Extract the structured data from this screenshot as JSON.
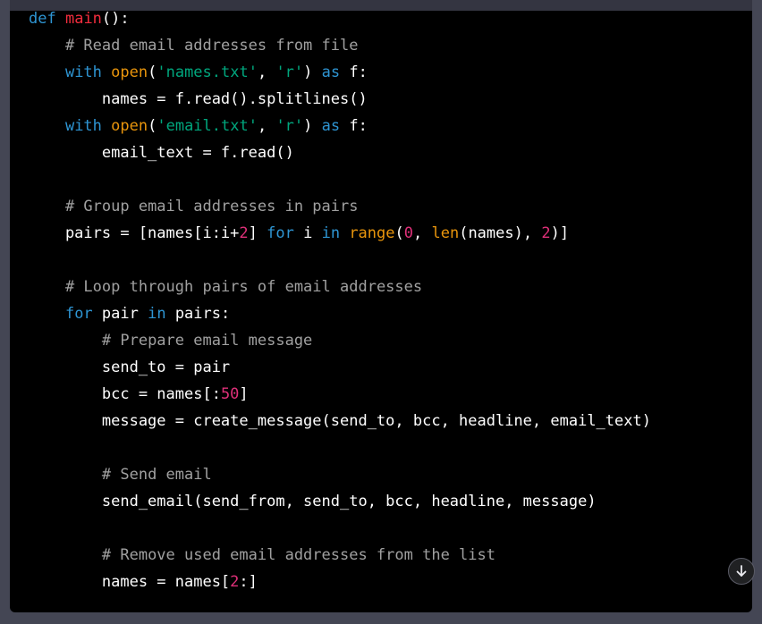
{
  "code_lines": [
    [
      {
        "t": "def",
        "c": "kw"
      },
      {
        "t": " "
      },
      {
        "t": "main",
        "c": "fn"
      },
      {
        "t": "():"
      }
    ],
    [
      {
        "t": "    "
      },
      {
        "t": "# Read email addresses from file",
        "c": "cm"
      }
    ],
    [
      {
        "t": "    "
      },
      {
        "t": "with",
        "c": "kw"
      },
      {
        "t": " "
      },
      {
        "t": "open",
        "c": "bi"
      },
      {
        "t": "("
      },
      {
        "t": "'names.txt'",
        "c": "str"
      },
      {
        "t": ", "
      },
      {
        "t": "'r'",
        "c": "str"
      },
      {
        "t": ") "
      },
      {
        "t": "as",
        "c": "kw"
      },
      {
        "t": " f:"
      }
    ],
    [
      {
        "t": "        names = f.read().splitlines()"
      }
    ],
    [
      {
        "t": "    "
      },
      {
        "t": "with",
        "c": "kw"
      },
      {
        "t": " "
      },
      {
        "t": "open",
        "c": "bi"
      },
      {
        "t": "("
      },
      {
        "t": "'email.txt'",
        "c": "str"
      },
      {
        "t": ", "
      },
      {
        "t": "'r'",
        "c": "str"
      },
      {
        "t": ") "
      },
      {
        "t": "as",
        "c": "kw"
      },
      {
        "t": " f:"
      }
    ],
    [
      {
        "t": "        email_text = f.read()"
      }
    ],
    [],
    [
      {
        "t": "    "
      },
      {
        "t": "# Group email addresses in pairs",
        "c": "cm"
      }
    ],
    [
      {
        "t": "    pairs = [names[i:i+"
      },
      {
        "t": "2",
        "c": "num"
      },
      {
        "t": "] "
      },
      {
        "t": "for",
        "c": "kw"
      },
      {
        "t": " i "
      },
      {
        "t": "in",
        "c": "kw"
      },
      {
        "t": " "
      },
      {
        "t": "range",
        "c": "bi"
      },
      {
        "t": "("
      },
      {
        "t": "0",
        "c": "num"
      },
      {
        "t": ", "
      },
      {
        "t": "len",
        "c": "bi"
      },
      {
        "t": "(names), "
      },
      {
        "t": "2",
        "c": "num"
      },
      {
        "t": ")]"
      }
    ],
    [],
    [
      {
        "t": "    "
      },
      {
        "t": "# Loop through pairs of email addresses",
        "c": "cm"
      }
    ],
    [
      {
        "t": "    "
      },
      {
        "t": "for",
        "c": "kw"
      },
      {
        "t": " pair "
      },
      {
        "t": "in",
        "c": "kw"
      },
      {
        "t": " pairs:"
      }
    ],
    [
      {
        "t": "        "
      },
      {
        "t": "# Prepare email message",
        "c": "cm"
      }
    ],
    [
      {
        "t": "        send_to = pair"
      }
    ],
    [
      {
        "t": "        bcc = names[:"
      },
      {
        "t": "50",
        "c": "num"
      },
      {
        "t": "]"
      }
    ],
    [
      {
        "t": "        message = create_message(send_to, bcc, headline, email_text)"
      }
    ],
    [],
    [
      {
        "t": "        "
      },
      {
        "t": "# Send email",
        "c": "cm"
      }
    ],
    [
      {
        "t": "        send_email(send_from, send_to, bcc, headline, message)"
      }
    ],
    [],
    [
      {
        "t": "        "
      },
      {
        "t": "# Remove used email addresses from the list",
        "c": "cm"
      }
    ],
    [
      {
        "t": "        names = names["
      },
      {
        "t": "2",
        "c": "num"
      },
      {
        "t": ":]"
      }
    ]
  ],
  "scroll_button": {
    "icon": "arrow-down-icon"
  }
}
